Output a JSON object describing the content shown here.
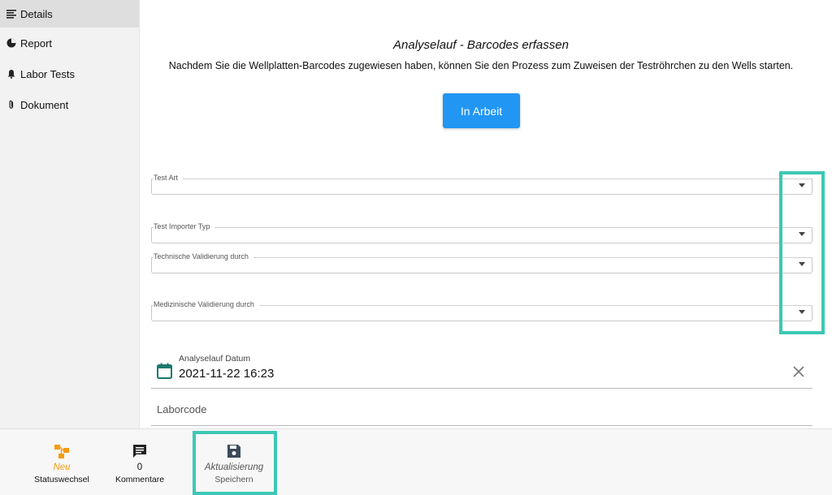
{
  "sidebar": {
    "items": [
      {
        "label": "Details",
        "icon": "list-icon",
        "active": true
      },
      {
        "label": "Report",
        "icon": "pie-chart-icon",
        "active": false
      },
      {
        "label": "Labor Tests",
        "icon": "bell-icon",
        "active": false
      },
      {
        "label": "Dokument",
        "icon": "paperclip-icon",
        "active": false
      }
    ]
  },
  "panel": {
    "title": "Analyselauf - Barcodes erfassen",
    "description": "Nachdem Sie die Wellplatten-Barcodes zugewiesen haben, können Sie den Prozess zum Zuweisen der Teströhrchen zu den Wells starten.",
    "status_button": "In Arbeit"
  },
  "form": {
    "test_art": {
      "label": "Test Art",
      "value": ""
    },
    "test_importer_typ": {
      "label": "Test Importer Typ",
      "value": ""
    },
    "technische_validierung": {
      "label": "Technische Validierung durch",
      "value": ""
    },
    "medizinische_validierung": {
      "label": "Medizinische Validierung durch",
      "value": ""
    },
    "analyselauf_datum": {
      "label": "Analyselauf Datum",
      "value": "2021-11-22 16:23"
    },
    "laborcode": {
      "label": "Laborcode",
      "value": ""
    }
  },
  "bottombar": {
    "statuswechsel": {
      "top": "Neu",
      "label": "Statuswechsel"
    },
    "kommentare": {
      "top": "0",
      "label": "Kommentare"
    },
    "speichern": {
      "top": "Aktualisierung",
      "label": "Speichern"
    }
  },
  "colors": {
    "accent": "#2196f3",
    "highlight": "#3cc8b4",
    "status_new": "#f39c12",
    "calendar": "#1a7a6e"
  }
}
